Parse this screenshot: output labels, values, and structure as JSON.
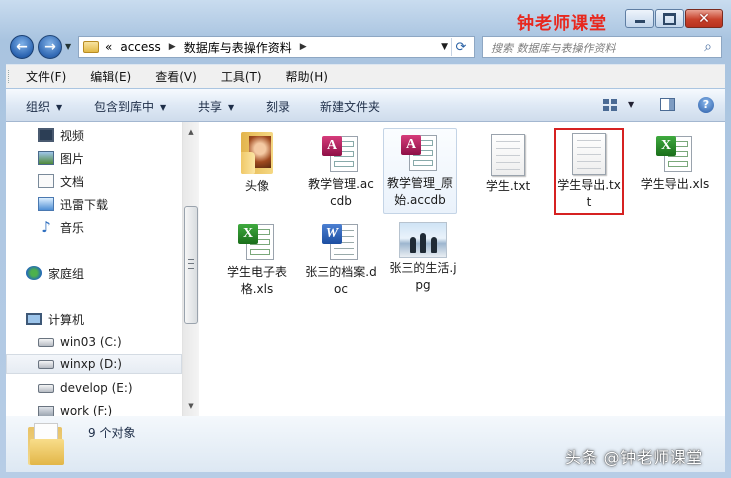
{
  "brand": "钟老师课堂",
  "watermark": "头条 @钟老师课堂",
  "address": {
    "overflow": "«",
    "crumbs": [
      "access",
      "数据库与表操作资料"
    ]
  },
  "search": {
    "placeholder": "搜索 数据库与表操作资料"
  },
  "menu": [
    "文件(F)",
    "编辑(E)",
    "查看(V)",
    "工具(T)",
    "帮助(H)"
  ],
  "commands": [
    "组织",
    "包含到库中",
    "共享",
    "刻录",
    "新建文件夹"
  ],
  "nav": [
    {
      "label": "视频",
      "icon": "video-icon"
    },
    {
      "label": "图片",
      "icon": "pictures-icon"
    },
    {
      "label": "文档",
      "icon": "documents-icon"
    },
    {
      "label": "迅雷下载",
      "icon": "download-icon"
    },
    {
      "label": "音乐",
      "icon": "music-icon"
    },
    {
      "label": "家庭组",
      "icon": "homegroup-icon"
    },
    {
      "label": "计算机",
      "icon": "computer-icon"
    },
    {
      "label": "win03 (C:)",
      "icon": "drive-icon"
    },
    {
      "label": "winxp (D:)",
      "icon": "drive-icon",
      "selected": true
    },
    {
      "label": "develop (E:)",
      "icon": "drive-icon"
    },
    {
      "label": "work (F:)",
      "icon": "network-drive-icon"
    }
  ],
  "files": [
    {
      "name": "头像",
      "type": "folder",
      "icon": "folder-icon"
    },
    {
      "name": "教学管理.accdb",
      "type": "access",
      "icon": "access-icon"
    },
    {
      "name": "教学管理_原始.accdb",
      "type": "access",
      "icon": "access-icon",
      "selected": true
    },
    {
      "name": "学生.txt",
      "type": "txt",
      "icon": "text-file-icon"
    },
    {
      "name": "学生导出.txt",
      "type": "txt",
      "icon": "text-file-icon",
      "highlighted": true
    },
    {
      "name": "学生导出.xls",
      "type": "xls",
      "icon": "excel-icon"
    },
    {
      "name": "学生电子表格.xls",
      "type": "xls",
      "icon": "excel-icon"
    },
    {
      "name": "张三的档案.doc",
      "type": "doc",
      "icon": "word-icon"
    },
    {
      "name": "张三的生活.jpg",
      "type": "jpg",
      "icon": "image-icon"
    }
  ],
  "status": {
    "count": "9 个对象"
  },
  "colors": {
    "brand": "#e8281e",
    "highlight": "#d62121",
    "accent": "#2b64b1"
  }
}
